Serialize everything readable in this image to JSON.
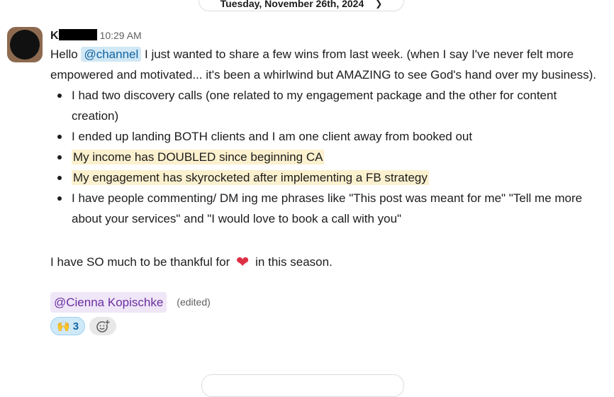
{
  "date_divider": {
    "label": "Tuesday, November 26th, 2024"
  },
  "message": {
    "author_initial": "K",
    "timestamp": "10:29 AM",
    "intro_before": "Hello ",
    "channel_mention": "@channel",
    "intro_after": " I just wanted to share a few wins from last week. (when I say I've never felt more empowered and motivated... it's been a whirlwind but AMAZING to see God's hand over my business).",
    "bullets": [
      "I had two discovery calls (one related to my engagement package and the other for content creation)",
      "I ended up landing BOTH clients and I am one client away from booked out",
      "My income has DOUBLED since beginning CA",
      "My engagement has skyrocketed after implementing a FB strategy",
      "I have people commenting/ DM ing me phrases like \"This post was meant for me\" \"Tell me more about your services\" and \"I would love to book a call with you\""
    ],
    "closing_before": "I have SO much to be thankful for ",
    "closing_after": " in this season.",
    "user_mention": "@Cienna Kopischke",
    "edited_label": "(edited)"
  },
  "reactions": [
    {
      "emoji": "🙌",
      "count": "3"
    }
  ],
  "icons": {
    "heart": "heart-icon",
    "add_reaction": "add-reaction-icon",
    "chevron": "chevron-down-icon"
  },
  "colors": {
    "mention_bg": "#d1e8f5",
    "highlight_bg": "#fcf1cf",
    "user_mention_bg": "#efe6f7",
    "reaction_bg": "#cfe9f9"
  }
}
